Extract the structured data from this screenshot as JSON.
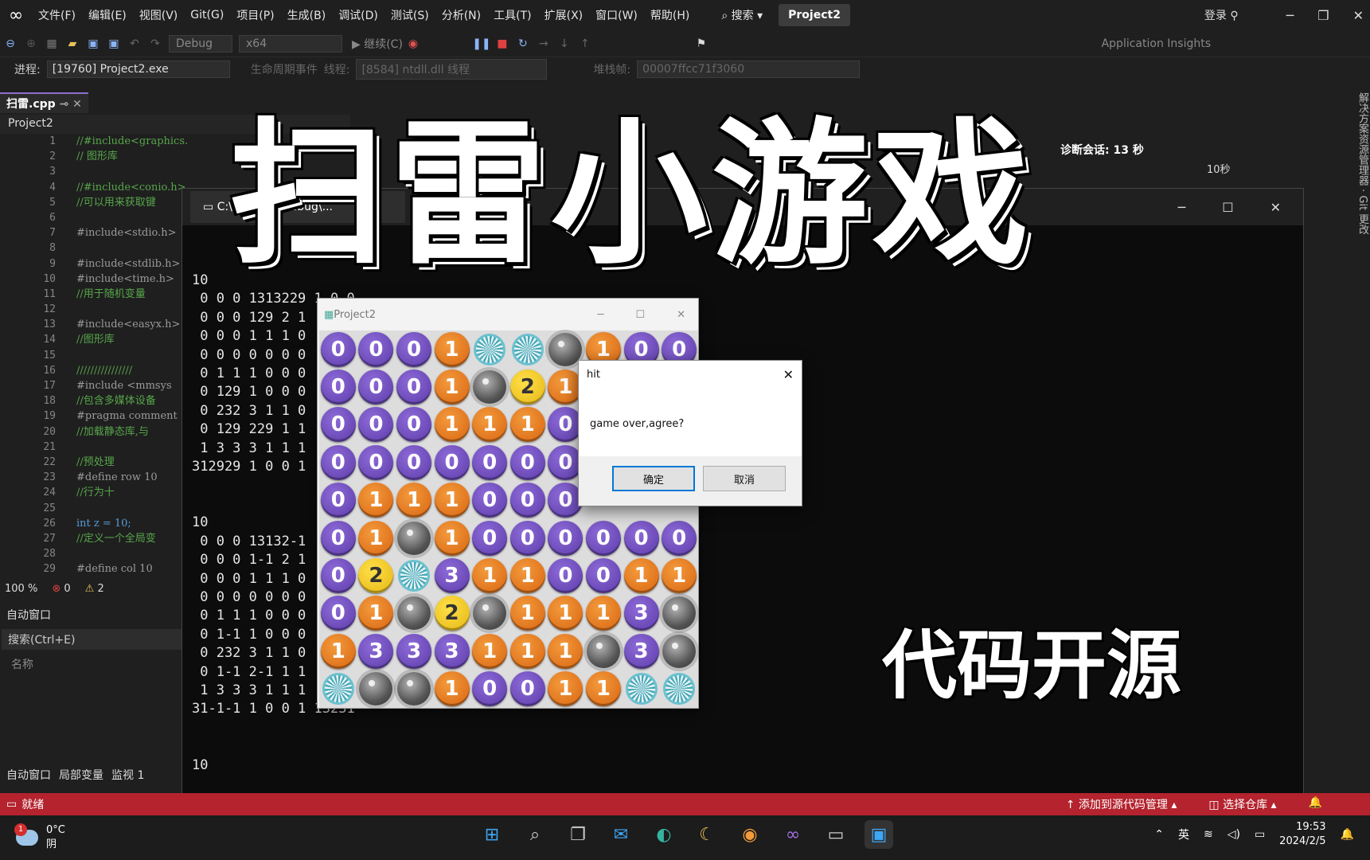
{
  "menu": {
    "items": [
      "文件(F)",
      "编辑(E)",
      "视图(V)",
      "Git(G)",
      "项目(P)",
      "生成(B)",
      "调试(D)",
      "测试(S)",
      "分析(N)",
      "工具(T)",
      "扩展(X)",
      "窗口(W)",
      "帮助(H)"
    ],
    "search": "搜索",
    "project": "Project2",
    "login": "登录"
  },
  "toolbar": {
    "config": "Debug",
    "platform": "x64",
    "continue": "继续(C)",
    "app_insights": "Application Insights"
  },
  "procbar": {
    "process_label": "进程:",
    "process_value": "[19760] Project2.exe",
    "lifecycle": "生命周期事件",
    "thread_label": "线程:",
    "thread_value": "[8584] ntdll.dll 线程",
    "stack_label": "堆栈帧:",
    "stack_value": "00007ffcc71f3060"
  },
  "editor": {
    "file_tab": "扫雷.cpp",
    "project_dropdown": "Project2",
    "line_numbers": [
      "1",
      "2",
      "3",
      "4",
      "5",
      "6",
      "7",
      "8",
      "9",
      "10",
      "11",
      "12",
      "13",
      "14",
      "15",
      "16",
      "17",
      "18",
      "19",
      "20",
      "21",
      "22",
      "23",
      "24",
      "25",
      "26",
      "27",
      "28",
      "29"
    ],
    "code_lines": [
      "//#include<graphics.h>",
      "// 图形库",
      "",
      "//#include<conio.h>",
      "//可以用来获取键",
      "",
      "#include<stdio.h>",
      "",
      "#include<stdlib.h>",
      "#include<time.h>",
      "//用于随机变量",
      "",
      "#include<easyx.h>",
      "//图形库",
      "",
      "////////////////",
      "#include <mmsys",
      "//包含多媒体设备",
      "#pragma comment",
      "//加载静态库,与",
      "",
      "//预处理",
      "#define row 10",
      "//行为十",
      "",
      "int z = 10;",
      "//定义一个全局变",
      "",
      "#define col 10"
    ],
    "zoom": "100 %",
    "errors": "0",
    "warnings": "2"
  },
  "auto_panel": {
    "title": "自动窗口",
    "search": "搜索(Ctrl+E)",
    "name_col": "名称",
    "tabs": [
      "自动窗口",
      "局部变量",
      "监视 1"
    ]
  },
  "right_panel": {
    "diag_label": "诊断会话: 13 秒",
    "timeline": "10秒"
  },
  "console": {
    "tab_title": "C:\\Users\\...\\Debug\\...",
    "text": "10\n 0 0 0 1313229 1 0 0\n 0 0 0 129 2 1\n 0 0 0 1 1 1 0\n 0 0 0 0 0 0 0\n 0 1 1 1 0 0 0\n 0 129 1 0 0 0\n 0 232 3 1 1 0\n 0 129 229 1 1\n 1 3 3 3 1 1 1\n312929 1 0 0 1\n\n\n10\n 0 0 0 13132-1\n 0 0 0 1-1 2 1\n 0 0 0 1 1 1 0\n 0 0 0 0 0 0 0\n 0 1 1 1 0 0 0\n 0 1-1 1 0 0 0\n 0 232 3 1 1 0\n 0 1-1 2-1 1 1\n 1 3 3 3 1 1 1\n31-1-1 1 0 0 1 13231\n\n\n10"
  },
  "game": {
    "title": "Project2",
    "grid": [
      [
        "0",
        "0",
        "0",
        "1",
        "B",
        "B",
        "M",
        "1",
        "0",
        "0"
      ],
      [
        "0",
        "0",
        "0",
        "1",
        "M",
        "2",
        "1",
        "",
        "",
        ""
      ],
      [
        "0",
        "0",
        "0",
        "1",
        "1",
        "1",
        "0",
        "",
        "",
        ""
      ],
      [
        "0",
        "0",
        "0",
        "0",
        "0",
        "0",
        "0",
        "",
        "",
        ""
      ],
      [
        "0",
        "1",
        "1",
        "1",
        "0",
        "0",
        "0",
        "",
        "",
        ""
      ],
      [
        "0",
        "1",
        "M",
        "1",
        "0",
        "0",
        "0",
        "0",
        "0",
        "0"
      ],
      [
        "0",
        "2",
        "B",
        "3",
        "1",
        "1",
        "0",
        "0",
        "1",
        "1"
      ],
      [
        "0",
        "1",
        "M",
        "2",
        "M",
        "1",
        "1",
        "1",
        "3",
        "M"
      ],
      [
        "1",
        "3",
        "3",
        "3",
        "1",
        "1",
        "1",
        "M",
        "3",
        "M"
      ],
      [
        "B",
        "M",
        "M",
        "1",
        "0",
        "0",
        "1",
        "1",
        "B",
        "B"
      ]
    ]
  },
  "dialog": {
    "title": "hit",
    "message": "game over,agree?",
    "ok": "确定",
    "cancel": "取消"
  },
  "overlay": {
    "title": "扫雷小游戏",
    "subtitle": "代码开源"
  },
  "status": {
    "ready": "就绪",
    "source_control": "添加到源代码管理",
    "repo": "选择仓库"
  },
  "taskbar": {
    "temp": "0°C",
    "weather": "阴",
    "badge": "1",
    "ime": "英",
    "time": "19:53",
    "date": "2024/2/5"
  }
}
